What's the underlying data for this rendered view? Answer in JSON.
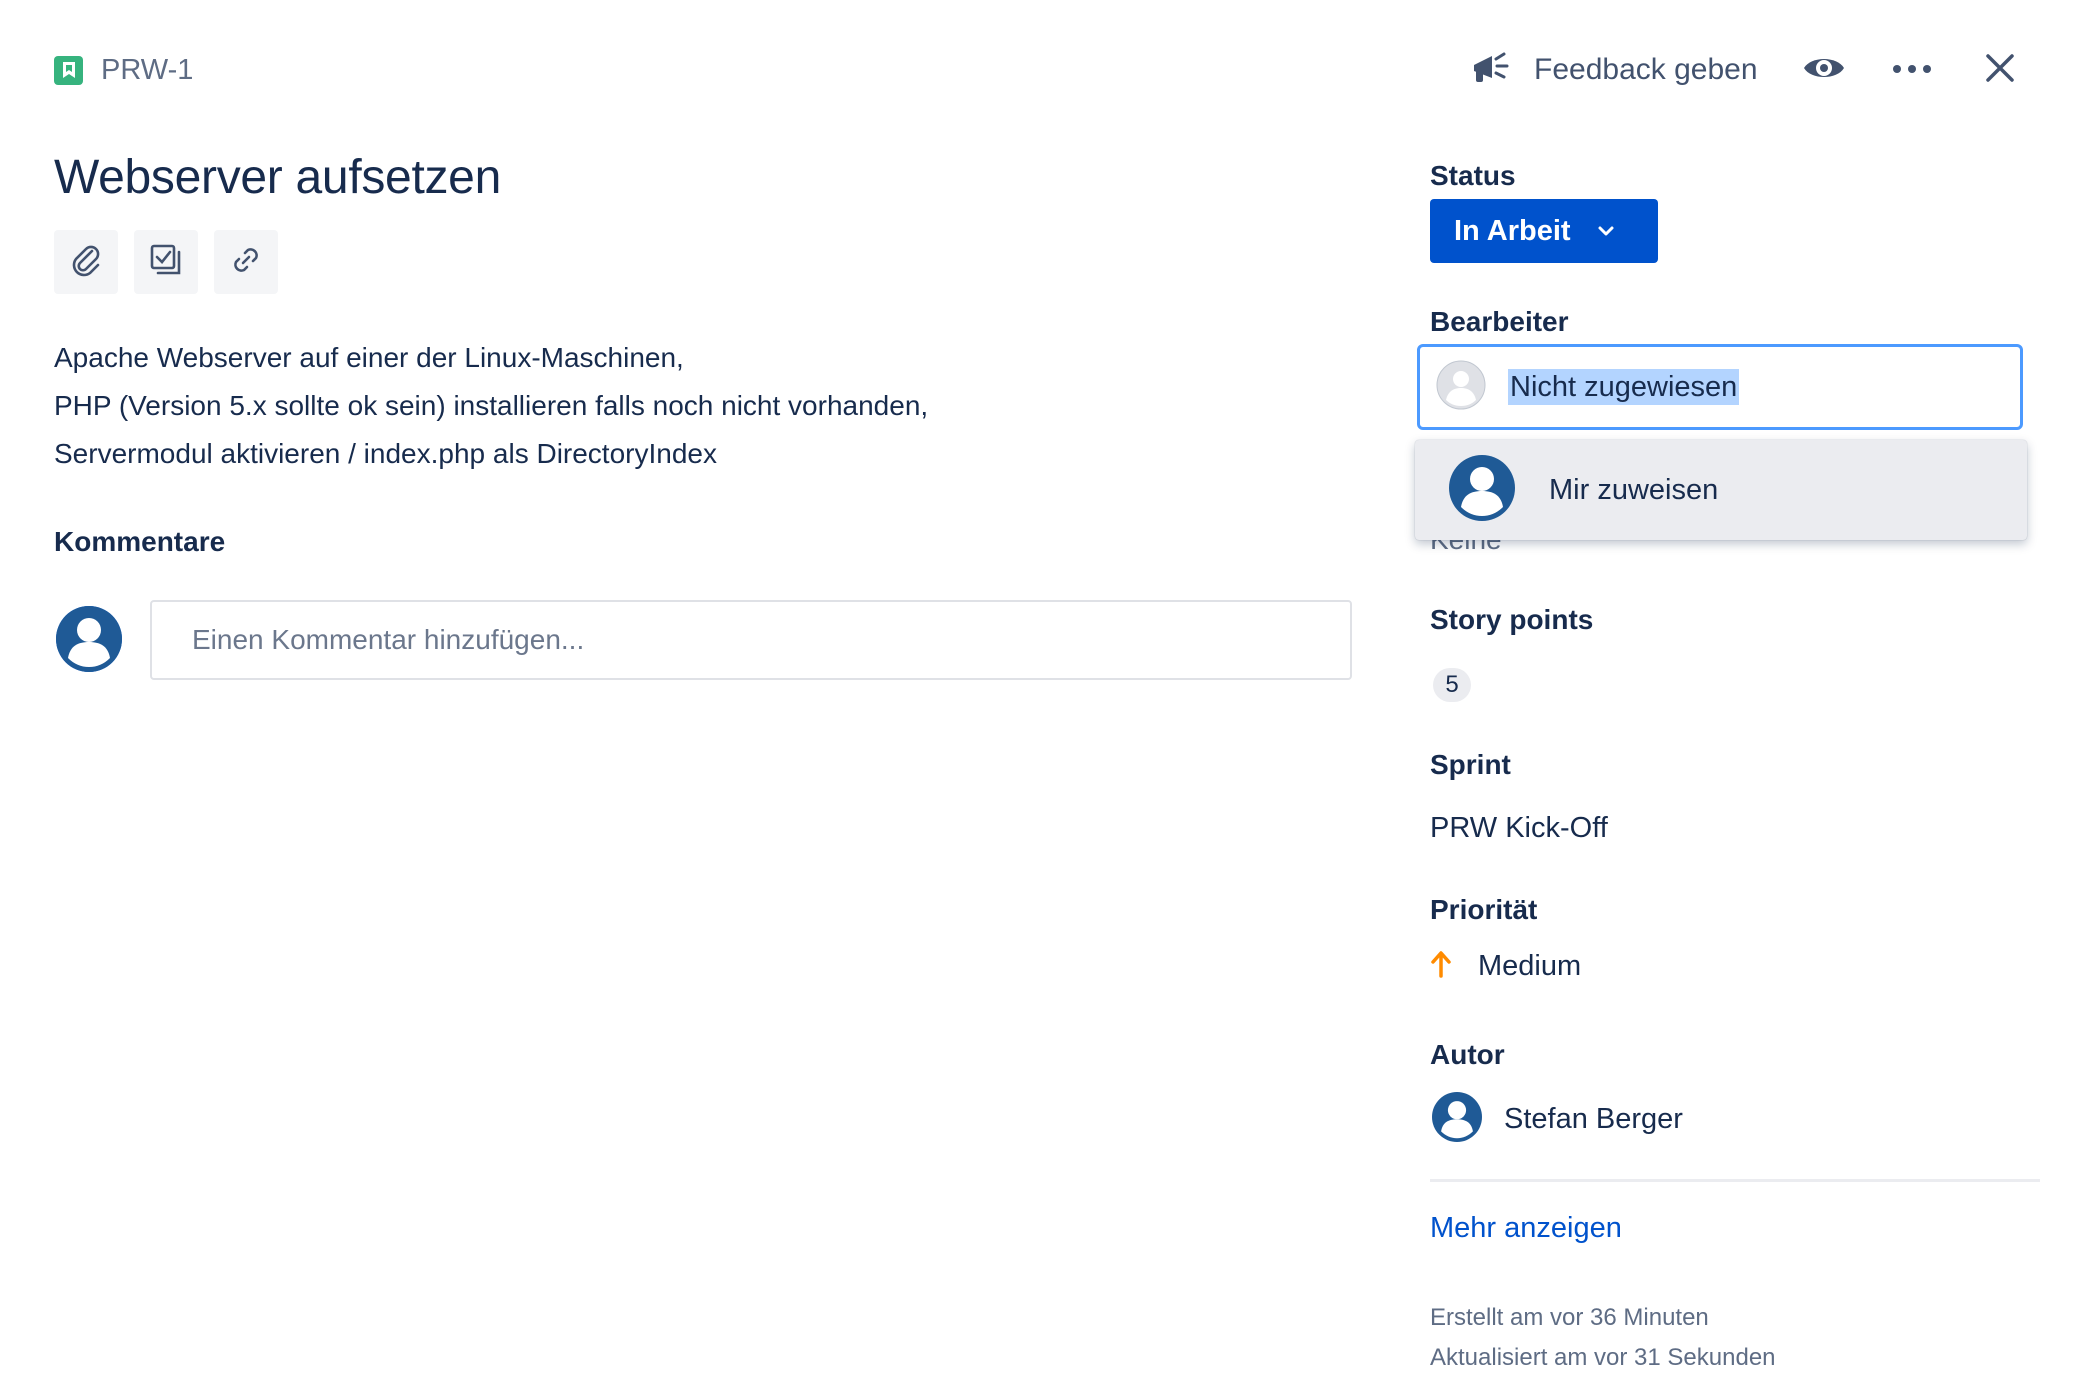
{
  "header": {
    "issue_key": "PRW-1",
    "feedback_label": "Feedback geben",
    "icons": [
      "story-icon",
      "megaphone-icon",
      "eye-icon",
      "more-icon",
      "close-icon"
    ]
  },
  "issue": {
    "title": "Webserver aufsetzen",
    "description_lines": [
      "Apache Webserver auf einer der Linux-Maschinen,",
      "PHP (Version 5.x sollte ok sein) installieren falls noch nicht vorhanden,",
      "Servermodul aktivieren / index.php als DirectoryIndex"
    ]
  },
  "comments": {
    "heading": "Kommentare",
    "placeholder": "Einen Kommentar hinzufügen..."
  },
  "sidebar": {
    "status": {
      "label": "Status",
      "value": "In Arbeit",
      "color": "#0052cc"
    },
    "assignee": {
      "label": "Bearbeiter",
      "value": "Nicht zugewiesen",
      "dropdown_option": "Mir zuweisen",
      "hidden_text": "Keine"
    },
    "story_points": {
      "label": "Story points",
      "value": "5"
    },
    "sprint": {
      "label": "Sprint",
      "value": "PRW Kick-Off"
    },
    "priority": {
      "label": "Priorität",
      "value": "Medium",
      "color": "#ff8b00"
    },
    "reporter": {
      "label": "Autor",
      "value": "Stefan Berger"
    },
    "more_link": "Mehr anzeigen",
    "created": "Erstellt am vor 36 Minuten",
    "updated": "Aktualisiert am vor 31 Sekunden"
  },
  "colors": {
    "accent": "#0052cc",
    "focus": "#4c9aff",
    "story": "#36b37e",
    "text": "#172b4d",
    "subtle": "#5e6c84"
  }
}
